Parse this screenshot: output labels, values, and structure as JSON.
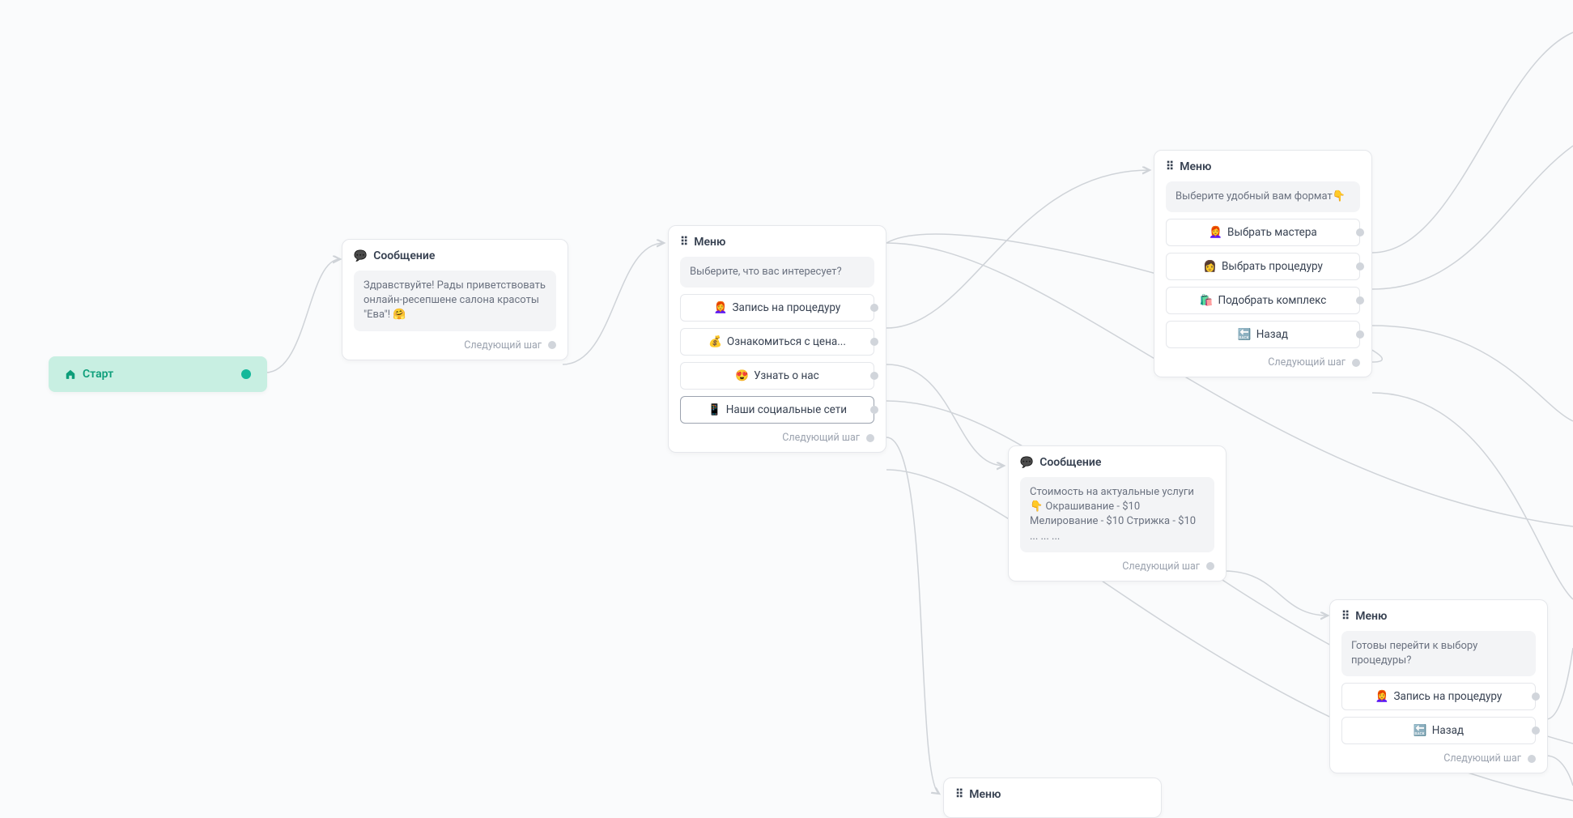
{
  "nodes": {
    "start": {
      "label": "Старт"
    },
    "msg1": {
      "title": "Сообщение",
      "body": "Здравствуйте! Рады приветствовать онлайн-ресепшене салона красоты \"Ева\"! 🤗",
      "next": "Следующий шаг"
    },
    "menu1": {
      "title": "Меню",
      "prompt": "Выберите, что вас интересует?",
      "buttons": [
        {
          "emoji": "👩‍🦰",
          "label": "Запись на процедуру"
        },
        {
          "emoji": "💰",
          "label": "Ознакомиться с цена..."
        },
        {
          "emoji": "😍",
          "label": "Узнать о нас"
        },
        {
          "emoji": "📱",
          "label": "Наши социальные сети"
        }
      ],
      "next": "Следующий шаг"
    },
    "menu2": {
      "title": "Меню",
      "prompt": "Выберите удобный вам формат👇",
      "buttons": [
        {
          "emoji": "👩‍🦰",
          "label": "Выбрать мастера"
        },
        {
          "emoji": "👩",
          "label": "Выбрать процедуру"
        },
        {
          "emoji": "🛍️",
          "label": "Подобрать комплекс"
        },
        {
          "emoji": "🔙",
          "label": "Назад"
        }
      ],
      "next": "Следующий шаг"
    },
    "msg2": {
      "title": "Сообщение",
      "body": "Стоимость на актуальные услуги👇 Окрашивание - $10 Мелирование - $10 Стрижка - $10 ... ... ...",
      "next": "Следующий шаг"
    },
    "menu3": {
      "title": "Меню",
      "prompt": "Готовы перейти к выбору процедуры?",
      "buttons": [
        {
          "emoji": "👩‍🦰",
          "label": "Запись на процедуру"
        },
        {
          "emoji": "🔙",
          "label": "Назад"
        }
      ],
      "next": "Следующий шаг"
    },
    "menu4": {
      "title": "Меню"
    }
  }
}
